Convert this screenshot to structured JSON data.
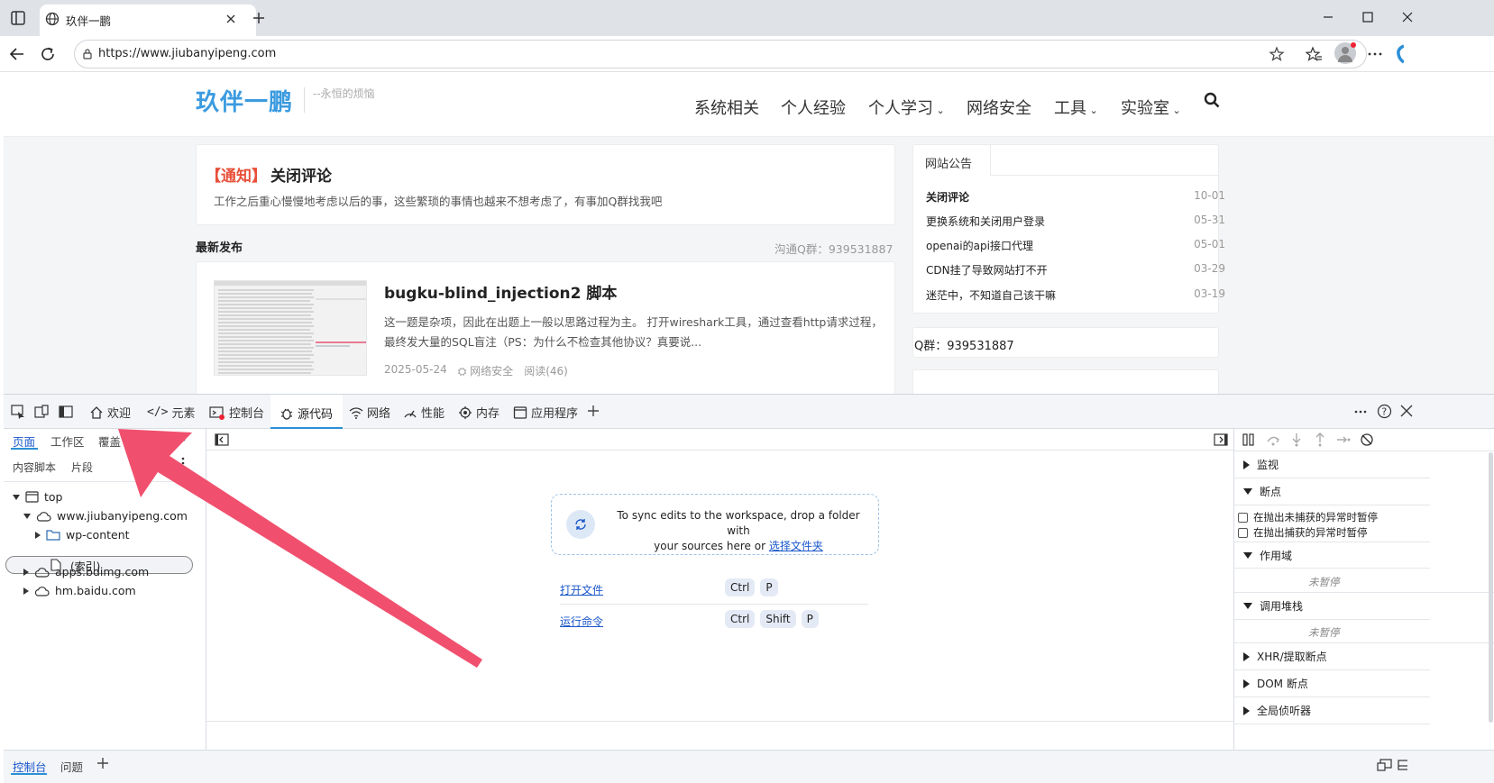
{
  "browser": {
    "tab_title": "玖伴一鹏",
    "url": "https://www.jiubanyipeng.com"
  },
  "site": {
    "logo": "玖伴一鹏",
    "tagline": "--永恒的烦恼",
    "nav": [
      {
        "label": "系统相关",
        "dropdown": false
      },
      {
        "label": "个人经验",
        "dropdown": false
      },
      {
        "label": "个人学习",
        "dropdown": true
      },
      {
        "label": "网络安全",
        "dropdown": false
      },
      {
        "label": "工具",
        "dropdown": true
      },
      {
        "label": "实验室",
        "dropdown": true
      }
    ],
    "notice": {
      "tag": "【通知】",
      "title": "关闭评论",
      "text": "工作之后重心慢慢地考虑以后的事，这些繁琐的事情也越来不想考虑了，有事加Q群找我吧"
    },
    "latest_label": "最新发布",
    "qq_group_hint": "沟通Q群：939531887",
    "post": {
      "title": "bugku-blind_injection2 脚本",
      "excerpt": "这一题是杂项，因此在出题上一般以思路过程为主。 打开wireshark工具，通过查看http请求过程，最终发大量的SQL盲注（PS：为什么不检查其他协议？真要说...",
      "date": "2025-05-24",
      "category": "网络安全",
      "views": "阅读(46)"
    },
    "announcements_title": "网站公告",
    "announcements": [
      {
        "text": "关闭评论",
        "date": "10-01"
      },
      {
        "text": "更换系统和关闭用户登录",
        "date": "05-31"
      },
      {
        "text": "openai的api接口代理",
        "date": "05-01"
      },
      {
        "text": "CDN挂了导致网站打不开",
        "date": "03-29"
      },
      {
        "text": "迷茫中，不知道自己该干嘛",
        "date": "03-19"
      }
    ],
    "qq_box": "Q群：939531887"
  },
  "devtools": {
    "tabs": [
      "欢迎",
      "元素",
      "控制台",
      "源代码",
      "网络",
      "性能",
      "内存",
      "应用程序"
    ],
    "active_tab": "源代码",
    "nav_tabs": [
      "页面",
      "工作区",
      "覆盖"
    ],
    "sub_tabs": [
      "内容脚本",
      "片段"
    ],
    "tree": {
      "top": "top",
      "domain1": "www.jiubanyipeng.com",
      "folder": "wp-content",
      "index": "(索引)",
      "domain2": "apps.bdimg.com",
      "domain3": "hm.baidu.com"
    },
    "workspace": {
      "sync_text_1": "To sync edits to the workspace, drop a folder with",
      "sync_text_2": "your sources here or",
      "select_folder": "选择文件夹",
      "open_file": "打开文件",
      "run_command": "运行命令",
      "keys_open": [
        "Ctrl",
        "P"
      ],
      "keys_run": [
        "Ctrl",
        "Shift",
        "P"
      ]
    },
    "right": {
      "watch": "监视",
      "breakpoints": "断点",
      "pause_uncaught": "在抛出未捕获的异常时暂停",
      "pause_caught": "在抛出捕获的异常时暂停",
      "scope": "作用域",
      "not_paused_1": "未暂停",
      "call_stack": "调用堆栈",
      "not_paused_2": "未暂停",
      "xhr": "XHR/提取断点",
      "dom": "DOM 断点",
      "global": "全局侦听器"
    },
    "drawer_tabs": [
      "控制台",
      "问题"
    ]
  },
  "colors": {
    "accent": "#2b8fd6",
    "logo_blue": "#3b9be0",
    "notice_red": "#e8503a",
    "arrow": "#f0506e",
    "link": "#1a57c9"
  }
}
